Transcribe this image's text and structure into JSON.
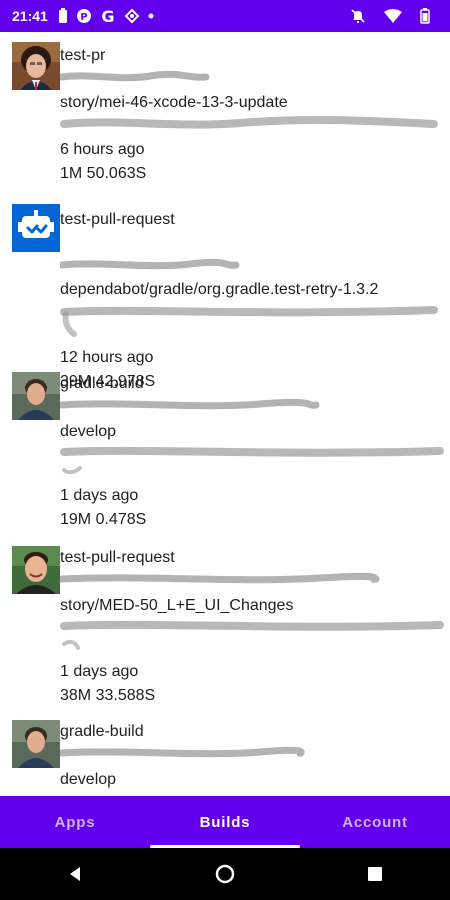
{
  "status_bar": {
    "time": "21:41",
    "left_icons": [
      "battery-saver-icon",
      "app-circle-icon",
      "google-icon",
      "cast-icon",
      "dot-icon"
    ],
    "right_icons": [
      "mute-icon",
      "wifi-icon",
      "battery-icon"
    ]
  },
  "builds": [
    {
      "avatar": "person-avatar",
      "title": "test-pr",
      "branch": "story/mei-46-xcode-13-3-update",
      "time_ago": "6 hours ago",
      "duration": "1M 50.063S"
    },
    {
      "avatar": "dependabot-avatar",
      "title": "test-pull-request",
      "branch": "dependabot/gradle/org.gradle.test-retry-1.3.2",
      "time_ago": "12 hours ago",
      "duration": "39M 42.978S"
    },
    {
      "avatar": "person-avatar",
      "title": "gradle-build",
      "branch": "develop",
      "time_ago": "1 days ago",
      "duration": "19M 0.478S"
    },
    {
      "avatar": "person-avatar",
      "title": "test-pull-request",
      "branch": "story/MED-50_L+E_UI_Changes",
      "time_ago": "1 days ago",
      "duration": "38M 33.588S"
    },
    {
      "avatar": "person-avatar",
      "title": "gradle-build",
      "branch": "develop"
    }
  ],
  "bottom_nav": {
    "tabs": [
      {
        "label": "Apps"
      },
      {
        "label": "Builds"
      },
      {
        "label": "Account"
      }
    ],
    "active": "Builds"
  },
  "colors": {
    "primary": "#6200ee",
    "on_primary": "#ffffff",
    "inactive_tab": "#c9b3f2"
  }
}
